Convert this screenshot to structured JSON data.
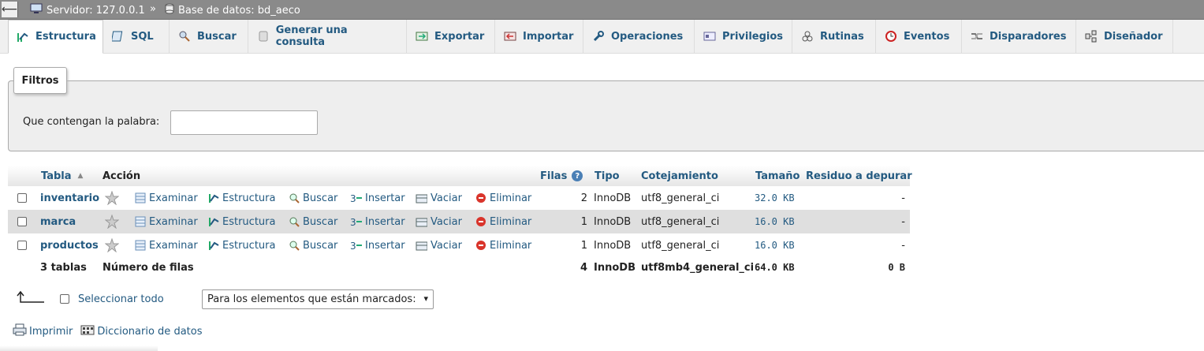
{
  "breadcrumb": {
    "server": "Servidor: 127.0.0.1",
    "separator": "»",
    "database": "Base de datos: bd_aeco"
  },
  "tabs": [
    {
      "label": "Estructura",
      "icon": "structure-icon",
      "active": true
    },
    {
      "label": "SQL",
      "icon": "sql-icon"
    },
    {
      "label": "Buscar",
      "icon": "search-icon"
    },
    {
      "label": "Generar una consulta",
      "icon": "query-icon"
    },
    {
      "label": "Exportar",
      "icon": "export-icon"
    },
    {
      "label": "Importar",
      "icon": "import-icon"
    },
    {
      "label": "Operaciones",
      "icon": "wrench-icon"
    },
    {
      "label": "Privilegios",
      "icon": "privileges-icon"
    },
    {
      "label": "Rutinas",
      "icon": "routines-icon"
    },
    {
      "label": "Eventos",
      "icon": "clock-icon"
    },
    {
      "label": "Disparadores",
      "icon": "triggers-icon"
    },
    {
      "label": "Diseñador",
      "icon": "designer-icon"
    }
  ],
  "filters": {
    "legend": "Filtros",
    "label": "Que contengan la palabra:",
    "value": ""
  },
  "table": {
    "headers": {
      "tabla": "Tabla",
      "accion": "Acción",
      "filas": "Filas",
      "tipo": "Tipo",
      "cotejamiento": "Cotejamiento",
      "tamano": "Tamaño",
      "residuo": "Residuo a depurar"
    },
    "action_labels": {
      "examinar": "Examinar",
      "estructura": "Estructura",
      "buscar": "Buscar",
      "insertar": "Insertar",
      "vaciar": "Vaciar",
      "eliminar": "Eliminar"
    },
    "rows": [
      {
        "name": "inventario",
        "rows": "2",
        "type": "InnoDB",
        "collation": "utf8_general_ci",
        "size": "32.0 KB",
        "overhead": "-"
      },
      {
        "name": "marca",
        "rows": "1",
        "type": "InnoDB",
        "collation": "utf8_general_ci",
        "size": "16.0 KB",
        "overhead": "-"
      },
      {
        "name": "productos",
        "rows": "1",
        "type": "InnoDB",
        "collation": "utf8_general_ci",
        "size": "16.0 KB",
        "overhead": "-"
      }
    ],
    "totals": {
      "tables": "3 tablas",
      "label": "Número de filas",
      "rows": "4",
      "type": "InnoDB",
      "collation": "utf8mb4_general_ci",
      "size": "64.0 KB",
      "overhead": "0 B"
    }
  },
  "bulk": {
    "select_all": "Seleccionar todo",
    "with_selected": "Para los elementos que están marcados:"
  },
  "links": {
    "print": "Imprimir",
    "dictionary": "Diccionario de datos"
  },
  "colors": {
    "link": "#235a81",
    "topbar": "#8a8a8a",
    "row_alt": "#dfdfdf",
    "delete": "#d9342b"
  }
}
